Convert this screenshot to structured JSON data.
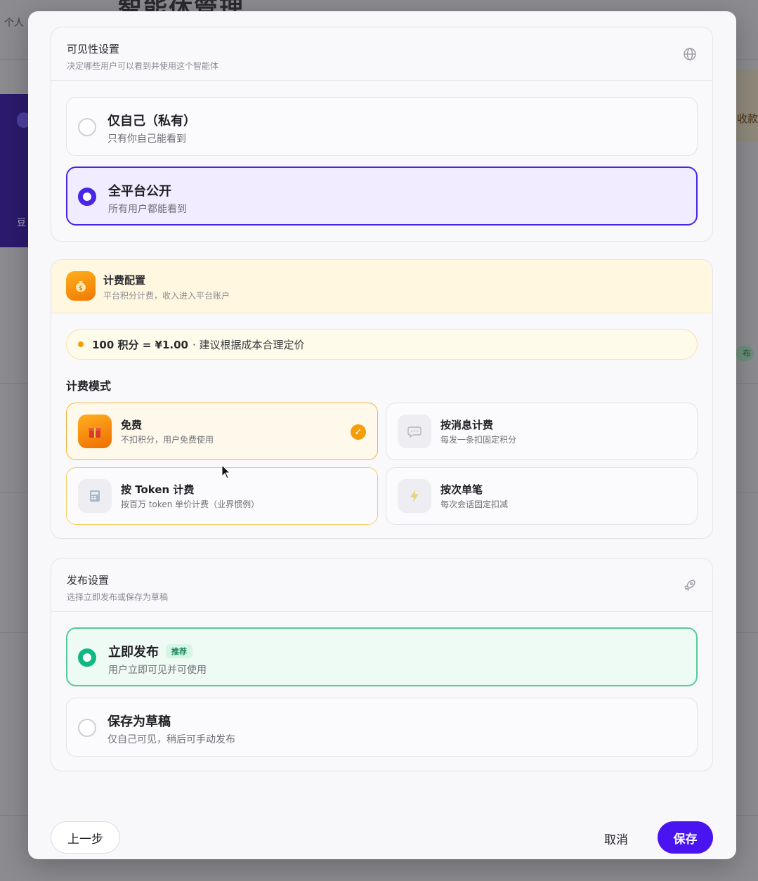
{
  "background": {
    "page_title": "智能体管理",
    "breadcrumb": "个人",
    "right_card_text": "收款",
    "right_badge": "布",
    "left_card_text": "豆"
  },
  "visibility": {
    "title": "可见性设置",
    "subtitle": "决定哪些用户可以看到并使用这个智能体",
    "icon": "globe-icon",
    "options": [
      {
        "label": "仅自己（私有）",
        "desc": "只有你自己能看到",
        "selected": false
      },
      {
        "label": "全平台公开",
        "desc": "所有用户都能看到",
        "selected": true
      }
    ]
  },
  "billing": {
    "title": "计费配置",
    "subtitle": "平台积分计费，收入进入平台账户",
    "icon": "money-bag-icon",
    "rate_strong": "100 积分 = ¥1.00",
    "rate_note": "· 建议根据成本合理定价",
    "mode_label": "计费模式",
    "modes": [
      {
        "label": "免费",
        "desc": "不扣积分，用户免费使用",
        "icon": "gift-icon",
        "selected": true
      },
      {
        "label": "按消息计费",
        "desc": "每发一条扣固定积分",
        "icon": "chat-icon",
        "selected": false
      },
      {
        "label": "按 Token 计费",
        "desc": "按百万 token 单价计费（业界惯例）",
        "icon": "calculator-icon",
        "selected": false
      },
      {
        "label": "按次单笔",
        "desc": "每次会话固定扣减",
        "icon": "lightning-icon",
        "selected": false
      }
    ]
  },
  "publish": {
    "title": "发布设置",
    "subtitle": "选择立即发布或保存为草稿",
    "icon": "rocket-icon",
    "options": [
      {
        "label": "立即发布",
        "tag": "推荐",
        "desc": "用户立即可见并可使用",
        "selected": true
      },
      {
        "label": "保存为草稿",
        "desc": "仅自己可见，稍后可手动发布",
        "selected": false
      }
    ]
  },
  "footer": {
    "back_label": "上一步",
    "cancel_label": "取消",
    "save_label": "保存"
  },
  "colors": {
    "primary": "#4a14f0",
    "green": "#10b981",
    "amber": "#f59e0b"
  }
}
